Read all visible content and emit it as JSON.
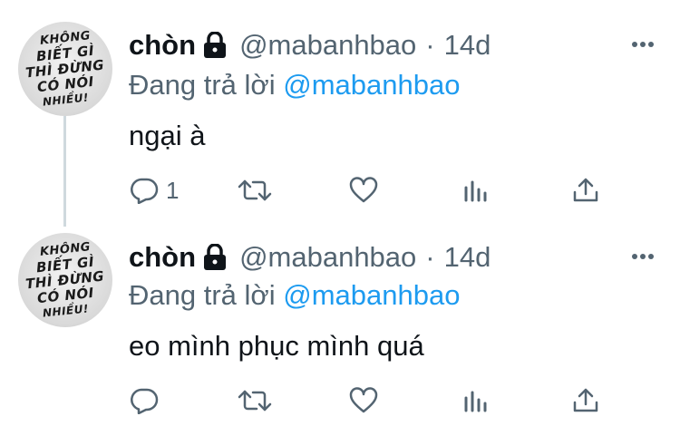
{
  "tweets": [
    {
      "author_name": "chòn",
      "handle": "@mabanhbao",
      "separator": "·",
      "time": "14d",
      "reply_prefix": "Đang trả lời",
      "reply_mention": "@mabanhbao",
      "text": "ngại à",
      "reply_count": "1",
      "avatar_text": [
        "KHÔNG",
        "BIẾT GÌ",
        "THÌ ĐỪNG",
        "CÓ NÓI",
        "NHIỀU!"
      ]
    },
    {
      "author_name": "chòn",
      "handle": "@mabanhbao",
      "separator": "·",
      "time": "14d",
      "reply_prefix": "Đang trả lời",
      "reply_mention": "@mabanhbao",
      "text": "eo mình phục mình quá",
      "reply_count": "",
      "avatar_text": [
        "KHÔNG",
        "BIẾT GÌ",
        "THÌ ĐỪNG",
        "CÓ NÓI",
        "NHIỀU!"
      ]
    }
  ],
  "icons": {
    "lock": "lock-icon",
    "more": "more-icon",
    "reply": "reply-icon",
    "retweet": "retweet-icon",
    "like": "heart-icon",
    "views": "views-icon",
    "share": "share-icon"
  },
  "colors": {
    "mention": "#1d9bf0",
    "secondary_text": "#536471",
    "icon": "#536471",
    "thread_line": "#cfd9de"
  }
}
